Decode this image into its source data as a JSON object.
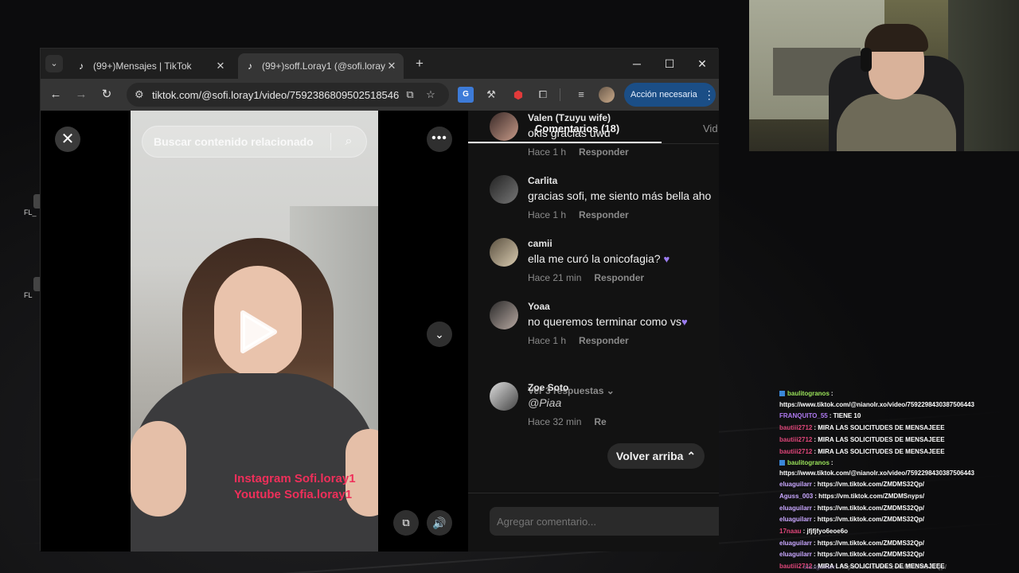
{
  "desktop": {
    "icons": [
      "FL_",
      "FL"
    ]
  },
  "browser": {
    "tabs": [
      {
        "title": "(99+)Mensajes | TikTok"
      },
      {
        "title": "(99+)soff.Loray1 (@sofi.loray1)"
      }
    ],
    "url": "tiktok.com/@sofi.loray1/video/7592386809502518546",
    "action_button": "Acción necesaria"
  },
  "video": {
    "search_placeholder": "Buscar contenido relacionado",
    "overlay_lines": [
      "Instagram Sofi.loray1",
      "Youtube Sofia.loray1"
    ]
  },
  "panel": {
    "tab_comments": "Comentarios (18)",
    "tab_videos": "Vid",
    "back_to_top": "Volver arriba",
    "comment_placeholder": "Agregar comentario..."
  },
  "comments": [
    {
      "user": "Valen (Tzuyu wife)",
      "text": "okis gracias uwu",
      "time": "Hace 1 h",
      "reply": "Responder"
    },
    {
      "user": "Carlita",
      "text": "gracias sofi, me siento más bella aho",
      "time": "Hace 1 h",
      "reply": "Responder"
    },
    {
      "user": "camii",
      "text": "ella me curó la onicofagia?",
      "time": "Hace 21 min",
      "reply": "Responder"
    },
    {
      "user": "Yoaa",
      "text": "no queremos terminar como vs",
      "time": "Hace 1 h",
      "reply": "Responder",
      "replies": "Ver 3 respuestas"
    },
    {
      "user": "Zoe Soto",
      "text": "@Piaa",
      "time": "Hace 32 min",
      "reply": "Re"
    }
  ],
  "chat": [
    {
      "name": "baulitogranos",
      "text": ":",
      "color": "#9ae35a",
      "badge": true
    },
    {
      "name": "",
      "text": "https://www.tiktok.com/@nianolr.xo/video/7592298430387506443",
      "color": "#ffffff"
    },
    {
      "name": "FRANQUITO_55",
      "text": ": TIENE 10",
      "color": "#b07af2"
    },
    {
      "name": "bautiii2712",
      "text": ": MIRA LAS SOLICITUDES DE MENSAJEEE",
      "color": "#e0467a"
    },
    {
      "name": "bautiii2712",
      "text": ": MIRA LAS SOLICITUDES DE MENSAJEEE",
      "color": "#e0467a"
    },
    {
      "name": "bautiii2712",
      "text": ": MIRA LAS SOLICITUDES DE MENSAJEEE",
      "color": "#e0467a"
    },
    {
      "name": "baulitogranos",
      "text": ":",
      "color": "#9ae35a",
      "badge": true
    },
    {
      "name": "",
      "text": "https://www.tiktok.com/@nianolr.xo/video/7592298430387506443",
      "color": "#ffffff"
    },
    {
      "name": "eluaguilarr",
      "text": ": https://vm.tiktok.com/ZMDMS32Qp/",
      "color": "#c9a7ff"
    },
    {
      "name": "Aguss_003",
      "text": ": https://vm.tiktok.com/ZMDMSnyps/",
      "color": "#c9a7ff"
    },
    {
      "name": "eluaguilarr",
      "text": ": https://vm.tiktok.com/ZMDMS32Qp/",
      "color": "#c9a7ff"
    },
    {
      "name": "eluaguilarr",
      "text": ": https://vm.tiktok.com/ZMDMS32Qp/",
      "color": "#c9a7ff"
    },
    {
      "name": "17naau",
      "text": ": jfjfjfyo6eoe6o",
      "color": "#e0467a"
    },
    {
      "name": "eluaguilarr",
      "text": ": https://vm.tiktok.com/ZMDMS32Qp/",
      "color": "#c9a7ff"
    },
    {
      "name": "eluaguilarr",
      "text": ": https://vm.tiktok.com/ZMDMS32Qp/",
      "color": "#c9a7ff"
    },
    {
      "name": "bautiii2712",
      "text": ": MIRA LAS SOLICITUDES DE MENSAJEEE",
      "color": "#e0467a"
    },
    {
      "name": "eluaguilarr",
      "text": ": https://vm.tiktok.com/ZMDMS32Qp/",
      "color": "#c9a7ff",
      "faded": true
    }
  ]
}
